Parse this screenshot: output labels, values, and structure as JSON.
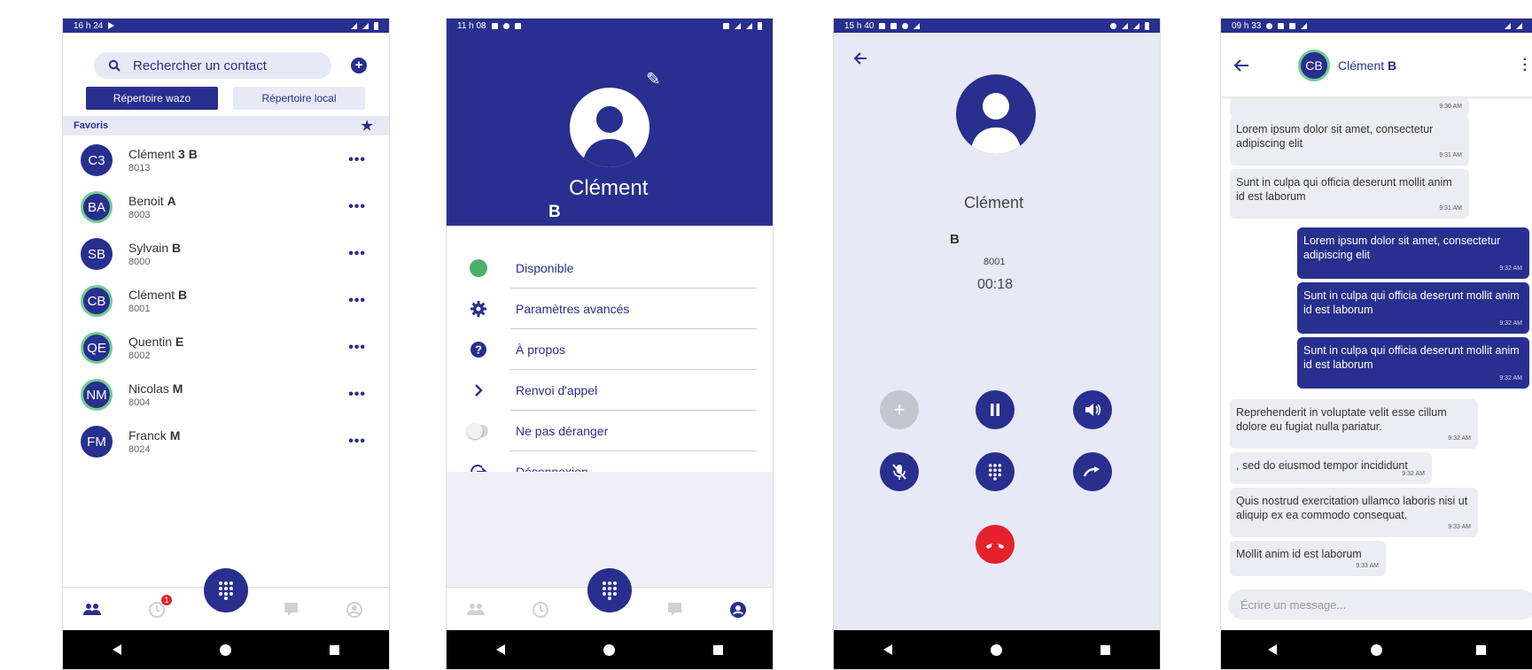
{
  "colors": {
    "primary": "#282f8e",
    "light": "#e8e9f6",
    "green": "#6fcf8f",
    "red": "#e5222c"
  },
  "phone1": {
    "time": "16 h 24",
    "search_placeholder": "Rechercher un contact",
    "dir_wazo": "Répertoire wazo",
    "dir_local": "Répertoire local",
    "favorites_label": "Favoris",
    "contacts": [
      {
        "initials": "C3",
        "first": "Clément",
        "last": "3 B",
        "number": "8013",
        "online": false
      },
      {
        "initials": "BA",
        "first": "Benoit",
        "last": "A",
        "number": "8003",
        "online": true
      },
      {
        "initials": "SB",
        "first": "Sylvain",
        "last": "B",
        "number": "8000",
        "online": false
      },
      {
        "initials": "CB",
        "first": "Clément",
        "last": "B",
        "number": "8001",
        "online": true
      },
      {
        "initials": "QE",
        "first": "Quentin",
        "last": "E",
        "number": "8002",
        "online": true
      },
      {
        "initials": "NM",
        "first": "Nicolas",
        "last": "M",
        "number": "8004",
        "online": true
      },
      {
        "initials": "FM",
        "first": "Franck",
        "last": "M",
        "number": "8024",
        "online": false
      }
    ],
    "more_label": "•••",
    "badge_count": "1"
  },
  "phone2": {
    "time": "11 h 08",
    "first_name": "Clément",
    "last_name": "B",
    "menu": [
      {
        "icon": "status-dot-icon",
        "label": "Disponible"
      },
      {
        "icon": "gear-icon",
        "label": "Paramètres avancés"
      },
      {
        "icon": "help-icon",
        "label": "À propos"
      },
      {
        "icon": "chevron-right-icon",
        "label": "Renvoi d'appel"
      },
      {
        "icon": "toggle-icon",
        "label": "Ne pas déranger"
      },
      {
        "icon": "logout-icon",
        "label": "Déconnexion"
      }
    ]
  },
  "phone3": {
    "time": "15 h 40",
    "first_name": "Clément",
    "last_name": "B",
    "number": "8001",
    "duration": "00:18"
  },
  "phone4": {
    "time": "09 h 33",
    "contact_initials": "CB",
    "contact_first": "Clément",
    "contact_last": "B",
    "compose_placeholder": "Écrire un message...",
    "messages": [
      {
        "dir": "in",
        "text": "",
        "time": "9:30 AM"
      },
      {
        "dir": "in",
        "text": "Lorem ipsum dolor sit amet, consectetur adipiscing elit",
        "time": "9:31 AM"
      },
      {
        "dir": "in",
        "text": "Sunt in culpa qui officia deserunt mollit anim id est laborum",
        "time": "9:31 AM"
      },
      {
        "dir": "out",
        "text": "Lorem ipsum dolor sit amet, consectetur adipiscing elit",
        "time": "9:32 AM"
      },
      {
        "dir": "out",
        "text": "Sunt in culpa qui officia deserunt mollit anim id est laborum",
        "time": "9:32 AM"
      },
      {
        "dir": "out",
        "text": "Sunt in culpa qui officia deserunt mollit anim id est laborum",
        "time": "9:32 AM"
      },
      {
        "dir": "in",
        "text": "Reprehenderit in voluptate velit esse cillum dolore eu fugiat nulla pariatur.",
        "time": "9:32 AM"
      },
      {
        "dir": "in",
        "text": ", sed do eiusmod tempor incididunt",
        "time": "9:32 AM"
      },
      {
        "dir": "in",
        "text": "Quis nostrud exercitation ullamco laboris nisi ut aliquip ex ea commodo consequat.",
        "time": "9:33 AM"
      },
      {
        "dir": "in",
        "text": "Mollit anim id est laborum",
        "time": "9:33 AM"
      }
    ]
  }
}
